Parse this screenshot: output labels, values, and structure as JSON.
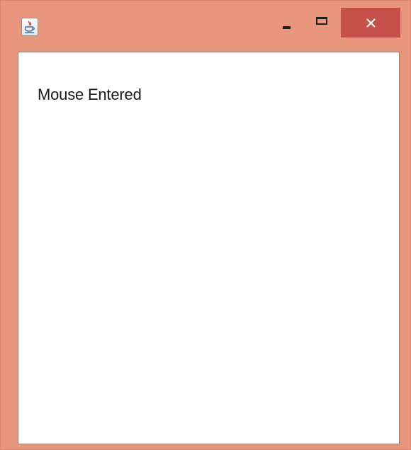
{
  "window": {
    "title": "",
    "frame_color": "#e9967e",
    "close_color": "#c7504a"
  },
  "icons": {
    "app": "java-cup-icon",
    "minimize": "minimize-icon",
    "maximize": "maximize-icon",
    "close": "close-icon"
  },
  "content": {
    "label_text": "Mouse Entered"
  }
}
